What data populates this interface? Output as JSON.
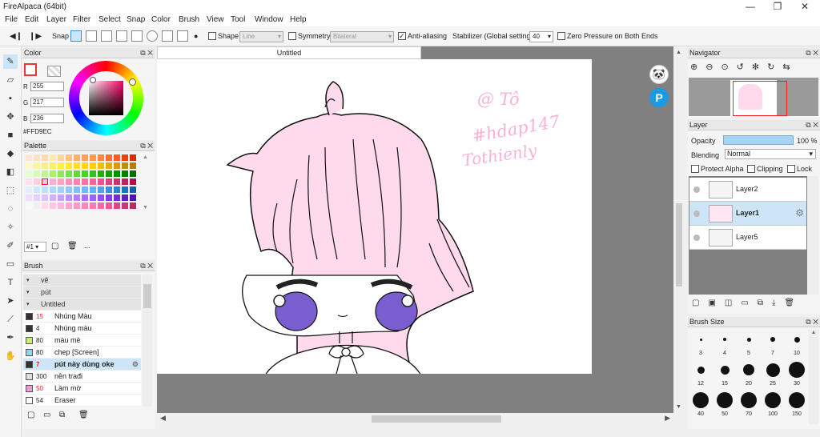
{
  "window": {
    "title": "FireAlpaca (64bit)",
    "minimize": "—",
    "maximize": "❐",
    "close": "✕"
  },
  "menu": [
    "File",
    "Edit",
    "Layer",
    "Filter",
    "Select",
    "Snap",
    "Color",
    "Brush",
    "View",
    "Tool",
    "Window",
    "Help"
  ],
  "toolbar": {
    "snap": "Snap",
    "shape": "Shape",
    "shape_value": "Line",
    "symmetry": "Symmetry",
    "symmetry_value": "Bilateral",
    "antialiasing": "Anti-aliasing",
    "stabilizer": "Stabilizer (Global settings)",
    "stabilizer_value": "40",
    "zero_pressure": "Zero Pressure on Both Ends"
  },
  "color": {
    "title": "Color",
    "r_label": "R",
    "r": "255",
    "g_label": "G",
    "g": "217",
    "b_label": "B",
    "b": "236",
    "hex": "#FFD9EC",
    "current": "#FFD9EC"
  },
  "palette": {
    "title": "Palette",
    "selector": "#1",
    "more": "..."
  },
  "brush": {
    "title": "Brush",
    "groups": [
      "vẽ",
      "pút",
      "Untitled"
    ],
    "items": [
      {
        "size": "15",
        "name": "Nhúng Màu",
        "color": "#333333",
        "red": true
      },
      {
        "size": "4",
        "name": "Nhúng màu",
        "color": "#333333",
        "red": false
      },
      {
        "size": "80",
        "name": "màu mè",
        "color": "#c8ec7c",
        "red": false
      },
      {
        "size": "80",
        "name": "chep [Screen]",
        "color": "#8fd6ee",
        "red": false
      },
      {
        "size": "7",
        "name": "pút này dùng oke",
        "color": "#333333",
        "red": true,
        "selected": true
      },
      {
        "size": "300",
        "name": "nền trađi",
        "color": "#dddddd",
        "red": false
      },
      {
        "size": "50",
        "name": "Làm mờ",
        "color": "#f29ad9",
        "red": true
      },
      {
        "size": "54",
        "name": "Eraser",
        "color": "#ffffff",
        "red": false
      }
    ]
  },
  "document": {
    "tab": "Untitled",
    "watermark": [
      "@ Tô",
      "#hdap147",
      "Tothienly"
    ]
  },
  "navigator": {
    "title": "Navigator"
  },
  "layer": {
    "title": "Layer",
    "opacity_label": "Opacity",
    "opacity": "100 %",
    "blending_label": "Blending",
    "blending": "Normal",
    "protect_alpha": "Protect Alpha",
    "clipping": "Clipping",
    "lock": "Lock",
    "layers": [
      {
        "name": "Layer2",
        "selected": false
      },
      {
        "name": "Layer1",
        "selected": true
      },
      {
        "name": "Layer5",
        "selected": false
      }
    ]
  },
  "brush_size": {
    "title": "Brush Size",
    "sizes": [
      "3",
      "4",
      "5",
      "7",
      "10",
      "12",
      "15",
      "20",
      "25",
      "30",
      "40",
      "50",
      "70",
      "100",
      "150"
    ]
  }
}
